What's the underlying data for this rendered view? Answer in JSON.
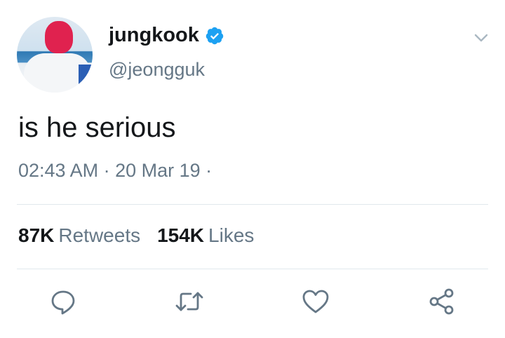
{
  "user": {
    "display_name": "jungkook",
    "handle": "@jeongguk",
    "verified": true
  },
  "tweet": {
    "text": "is he serious",
    "time": "02:43 AM",
    "separator": " · ",
    "date": "20 Mar 19",
    "trailing": " ·"
  },
  "stats": {
    "retweets_count": "87K",
    "retweets_label": "Retweets",
    "likes_count": "154K",
    "likes_label": "Likes"
  },
  "icons": {
    "reply": "reply-icon",
    "retweet": "retweet-icon",
    "like": "heart-icon",
    "share": "share-icon",
    "verified": "verified-badge-icon",
    "caret": "chevron-down-icon"
  },
  "colors": {
    "verified": "#1DA1F2",
    "icon": "#657786",
    "text": "#14171A",
    "secondary": "#657786",
    "divider": "#E1E8ED"
  }
}
